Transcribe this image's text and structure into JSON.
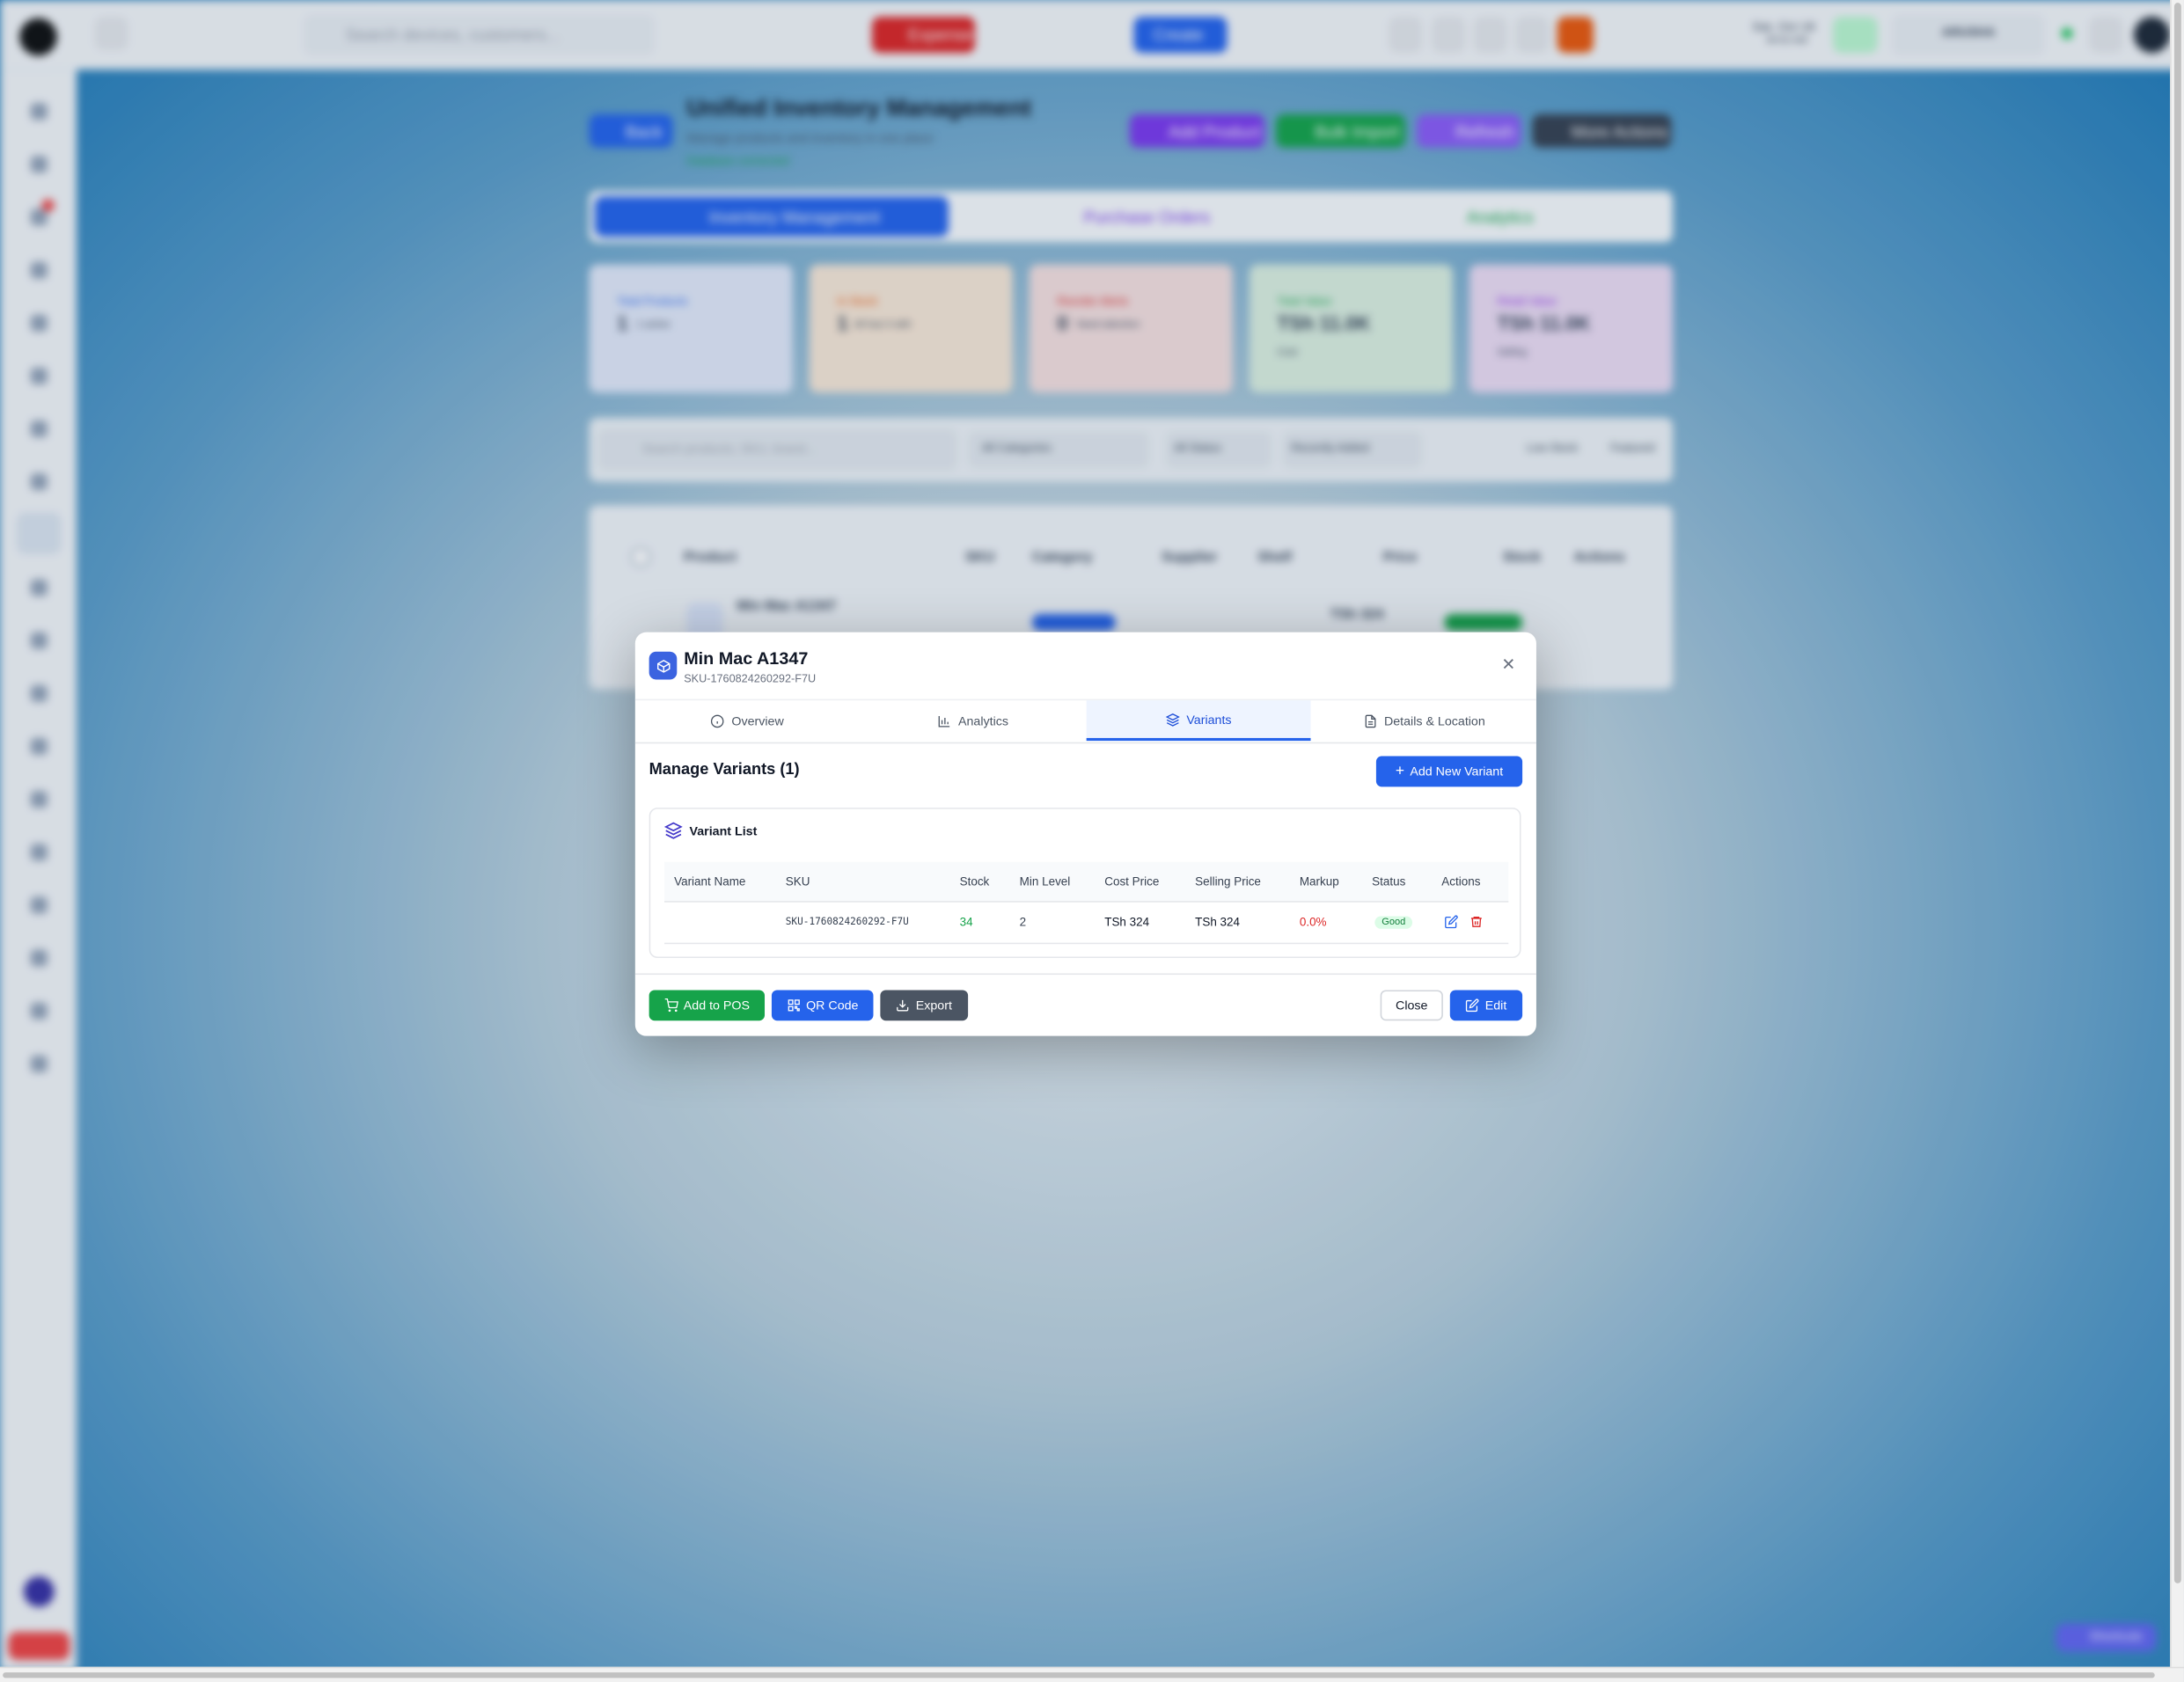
{
  "background": {
    "search_placeholder": "Search devices, customers...",
    "expense_label": "Expense",
    "create_label": "Create",
    "date": "Sat, Oct 18",
    "time": "09:52 AM",
    "user_name": "ARUSHA",
    "page_title": "Unified Inventory Management",
    "page_subtitle": "Manage products and inventory in one place",
    "db_status": "Database connected",
    "back_label": "Back",
    "header_buttons": [
      "Add Product",
      "Bulk Import",
      "Refresh",
      "More Actions"
    ],
    "main_tabs": [
      "Inventory Management",
      "Purchase Orders",
      "Analytics"
    ],
    "stats": [
      {
        "label": "Total Products",
        "value": "1",
        "sub": "1 active"
      },
      {
        "label": "In Stock",
        "value": "1",
        "sub": "All has 0 with"
      },
      {
        "label": "Reorder Alerts",
        "value": "0",
        "sub": "Need attention"
      },
      {
        "label": "Total Value",
        "value": "TSh 11.0K",
        "sub": "Cost"
      },
      {
        "label": "Retail Value",
        "value": "TSh 11.0K",
        "sub": "Selling"
      }
    ],
    "filter_search_placeholder": "Search products, SKU, brand...",
    "filter_category": "All Categories",
    "filter_status": "All Status",
    "filter_sort": "Recently Added",
    "filter_low_stock": "Low Stock",
    "filter_featured": "Featured",
    "table_headers": [
      "Product",
      "SKU",
      "Category",
      "Supplier",
      "Shelf",
      "Price",
      "Stock",
      "Actions"
    ],
    "row_product": "Min Mac A1347",
    "row_price": "TSh 324",
    "shortcut_label": "Shortcuts",
    "colors": {
      "expense": "#dc2626",
      "create": "#2563eb",
      "add_product": "#7c3aed",
      "bulk_import": "#16a34a",
      "refresh": "#8b5cf6",
      "more_actions": "#374151"
    }
  },
  "modal": {
    "title": "Min Mac A1347",
    "sku": "SKU-1760824260292-F7U",
    "tabs": [
      {
        "label": "Overview",
        "icon": "info-icon"
      },
      {
        "label": "Analytics",
        "icon": "bar-chart-icon"
      },
      {
        "label": "Variants",
        "icon": "layers-icon"
      },
      {
        "label": "Details & Location",
        "icon": "document-icon"
      }
    ],
    "active_tab": "Variants",
    "manage_title": "Manage Variants (1)",
    "add_variant_label": "Add New Variant",
    "variant_list_title": "Variant List",
    "columns": [
      "Variant Name",
      "SKU",
      "Stock",
      "Min Level",
      "Cost Price",
      "Selling Price",
      "Markup",
      "Status",
      "Actions"
    ],
    "rows": [
      {
        "name": "",
        "sku": "SKU-1760824260292-F7U",
        "stock": "34",
        "min_level": "2",
        "cost": "TSh 324",
        "selling": "TSh 324",
        "markup": "0.0%",
        "status": "Good"
      }
    ],
    "footer": {
      "add_to_pos": "Add to POS",
      "qr_code": "QR Code",
      "export": "Export",
      "close": "Close",
      "edit": "Edit"
    },
    "colors": {
      "primary": "#2563eb",
      "success": "#16a34a",
      "danger": "#dc2626",
      "neutral": "#4b5563"
    }
  }
}
